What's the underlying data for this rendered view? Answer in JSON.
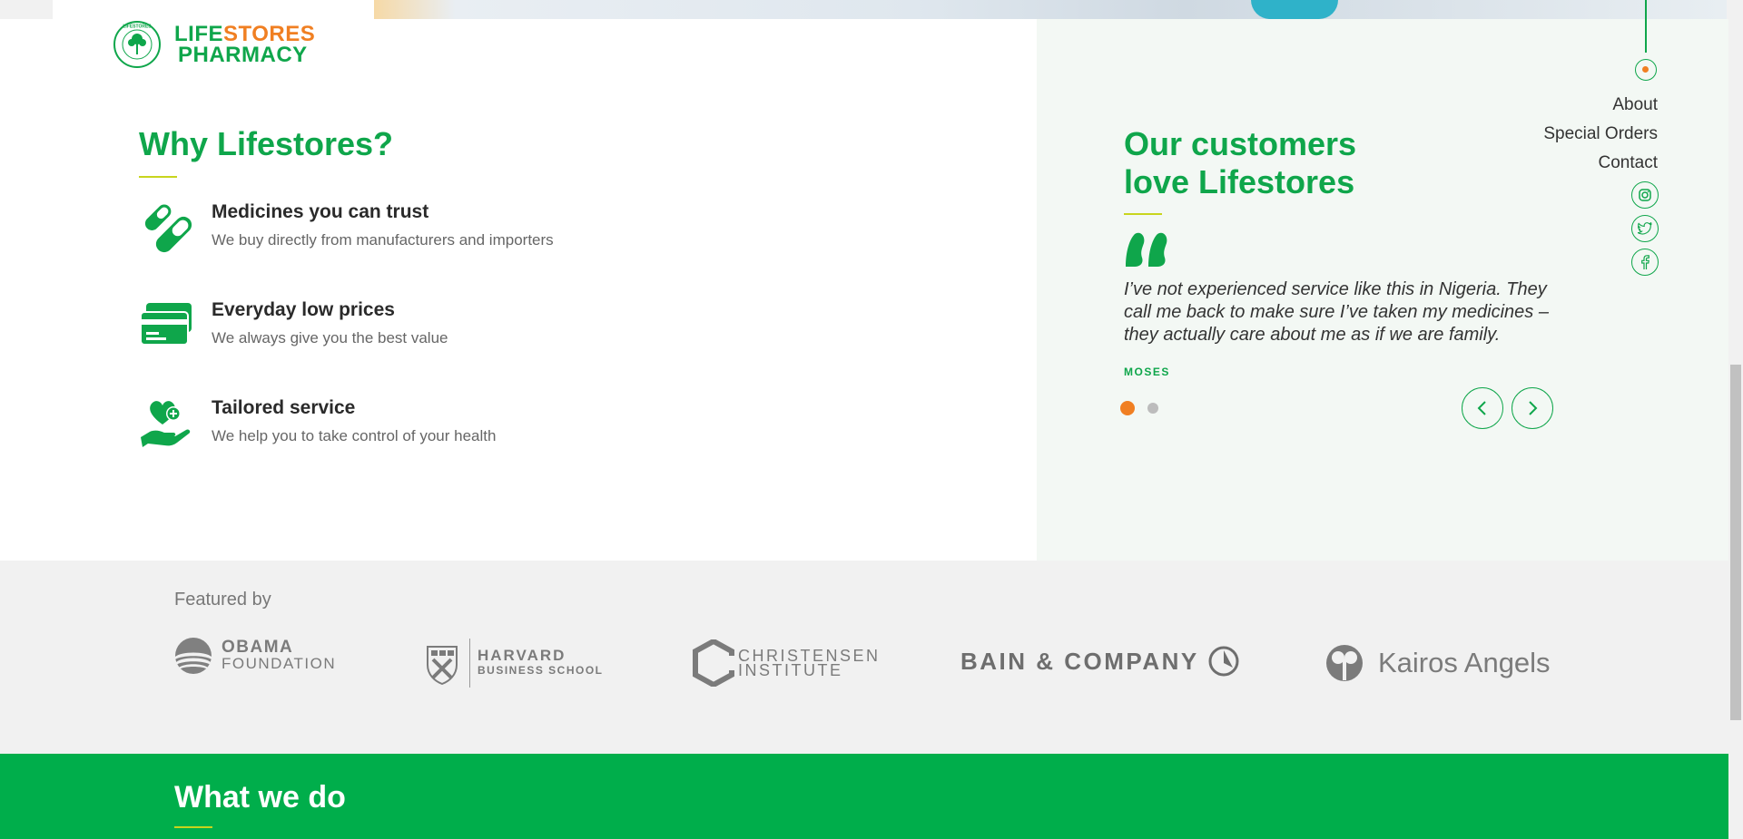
{
  "brand": {
    "line1_green": "LIFE",
    "line1_orange": "STORES",
    "line2": "PHARMACY",
    "seal_text": "LIFESTORES",
    "colors": {
      "green": "#0fa64b",
      "orange": "#f07f22",
      "accent_lime": "#c8d51d",
      "band_green": "#00ae4b"
    }
  },
  "why": {
    "title": "Why Lifestores?",
    "features": [
      {
        "icon": "pills-icon",
        "title": "Medicines you can trust",
        "text": "We buy directly from manufacturers and importers"
      },
      {
        "icon": "cards-icon",
        "title": "Everyday low prices",
        "text": "We always give you the best value"
      },
      {
        "icon": "heart-hand-icon",
        "title": "Tailored service",
        "text": "We help you to take control of your health"
      }
    ]
  },
  "testimonial": {
    "title_line1": "Our customers",
    "title_line2": "love Lifestores",
    "quote": "I’ve not experienced service like this in Nigeria. They call me back to make sure I’ve taken my medicines – they actually care about me as if we are family.",
    "author": "MOSES",
    "slides": 2,
    "active_slide": 1
  },
  "side_nav": {
    "items": [
      "About",
      "Special Orders",
      "Contact"
    ],
    "social": [
      "instagram-icon",
      "twitter-icon",
      "facebook-icon"
    ]
  },
  "featured": {
    "label": "Featured by",
    "partners": {
      "obama_line1": "OBAMA",
      "obama_line2": "FOUNDATION",
      "harvard_line1": "HARVARD",
      "harvard_line2": "BUSINESS SCHOOL",
      "christensen_line1": "CHRISTENSEN",
      "christensen_line2": "INSTITUTE",
      "bain": "BAIN & COMPANY",
      "kairos": "Kairos Angels"
    }
  },
  "what_we_do": {
    "title": "What we do"
  }
}
